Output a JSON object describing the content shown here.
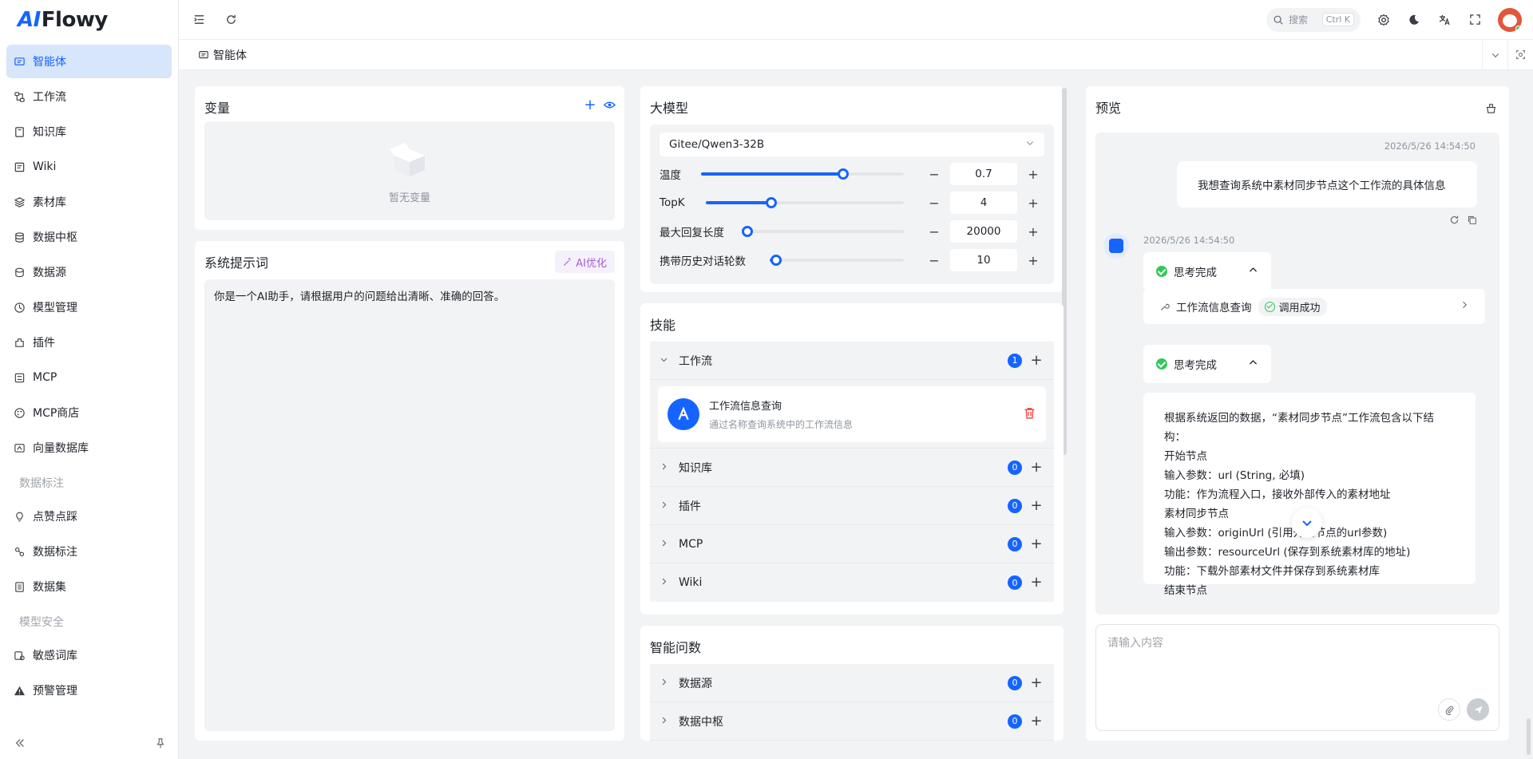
{
  "app": {
    "logo_mark": "AI",
    "logo_rest": "Flowy"
  },
  "sidebar": {
    "items": [
      {
        "label": "智能体",
        "icon": "chat-icon"
      },
      {
        "label": "工作流",
        "icon": "workflow-icon"
      },
      {
        "label": "知识库",
        "icon": "book-icon"
      },
      {
        "label": "Wiki",
        "icon": "wiki-icon"
      },
      {
        "label": "素材库",
        "icon": "layers-icon"
      },
      {
        "label": "数据中枢",
        "icon": "database-icon"
      },
      {
        "label": "数据源",
        "icon": "datasource-icon"
      },
      {
        "label": "模型管理",
        "icon": "model-icon"
      },
      {
        "label": "插件",
        "icon": "plugin-icon"
      },
      {
        "label": "MCP",
        "icon": "mcp-icon"
      },
      {
        "label": "MCP商店",
        "icon": "store-icon"
      },
      {
        "label": "向量数据库",
        "icon": "vector-icon"
      }
    ],
    "group1": "数据标注",
    "group1_items": [
      {
        "label": "点赞点踩",
        "icon": "bulb-icon"
      },
      {
        "label": "数据标注",
        "icon": "annotate-icon"
      },
      {
        "label": "数据集",
        "icon": "dataset-icon"
      }
    ],
    "group2": "模型安全",
    "group2_items": [
      {
        "label": "敏感词库",
        "icon": "sensitive-icon"
      },
      {
        "label": "预警管理",
        "icon": "warning-icon"
      }
    ]
  },
  "header": {
    "search_placeholder": "搜索",
    "search_shortcut": "Ctrl K"
  },
  "tabs": {
    "current": "智能体"
  },
  "variables": {
    "title": "变量",
    "empty_text": "暂无变量"
  },
  "system_prompt": {
    "title": "系统提示词",
    "ai_button": "AI优化",
    "content": "你是一个AI助手，请根据用户的问题给出清晰、准确的回答。"
  },
  "model": {
    "title": "大模型",
    "selected": "Gitee/Qwen3-32B",
    "params": [
      {
        "label": "温度",
        "value": "0.7",
        "level": 0.7
      },
      {
        "label": "TopK",
        "value": "4",
        "level": 0.33
      },
      {
        "label": "最大回复长度",
        "value": "20000",
        "level": 0.02
      },
      {
        "label": "携带历史对话轮数",
        "value": "10",
        "level": 0.05
      }
    ]
  },
  "skills": {
    "title": "技能",
    "workflow": {
      "label": "工作流",
      "count": "1"
    },
    "workflow_card": {
      "name": "工作流信息查询",
      "desc": "通过名称查询系统中的工作流信息"
    },
    "knowledge": {
      "label": "知识库",
      "count": "0"
    },
    "plugin": {
      "label": "插件",
      "count": "0"
    },
    "mcp": {
      "label": "MCP",
      "count": "0"
    },
    "wiki": {
      "label": "Wiki",
      "count": "0"
    }
  },
  "smart_query": {
    "title": "智能问数",
    "datasource": {
      "label": "数据源",
      "count": "0"
    },
    "datahub": {
      "label": "数据中枢",
      "count": "0"
    }
  },
  "preview": {
    "title": "预览",
    "user_time": "2026/5/26 14:54:50",
    "user_message": "我想查询系统中素材同步节点这个工作流的具体信息",
    "bot_time": "2026/5/26 14:54:50",
    "think_label": "思考完成",
    "tool_name": "工作流信息查询",
    "tool_status": "调用成功",
    "answer_lines": [
      "根据系统返回的数据，“素材同步节点”工作流包含以下结",
      "构：",
      "开始节点",
      "输入参数：url (String, 必填)",
      "功能：作为流程入口，接收外部传入的素材地址",
      "素材同步节点",
      "输入参数：originUrl (引用开始节点的url参数)",
      "输出参数：resourceUrl (保存到系统素材库的地址)",
      "功能：下载外部素材文件并保存到系统素材库",
      "结束节点"
    ],
    "input_placeholder": "请输入内容"
  },
  "colors": {
    "accent": "#1664ff",
    "success": "#34c759",
    "danger": "#f54a45",
    "ai_purple": "#a05fdc"
  }
}
